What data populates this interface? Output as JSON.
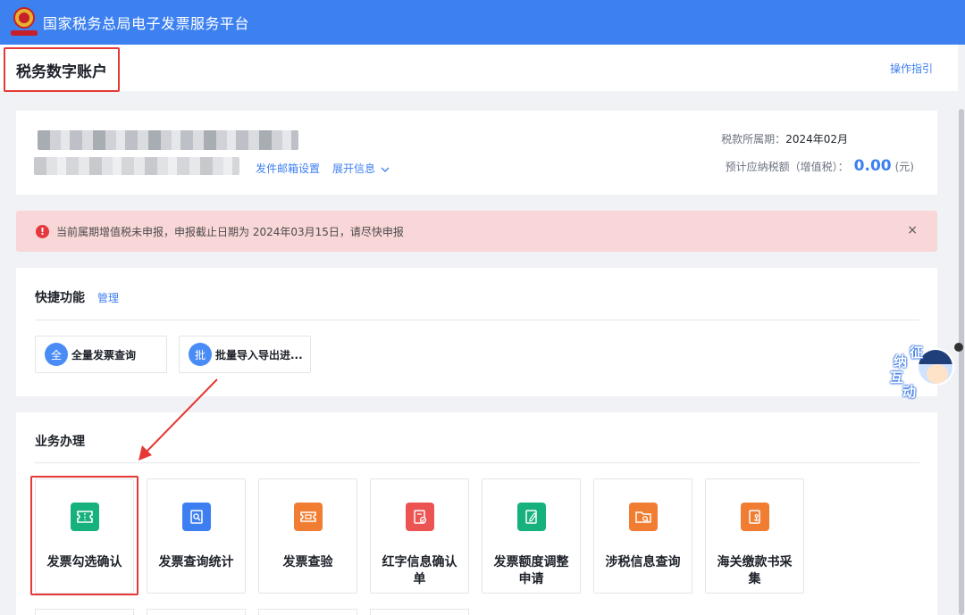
{
  "header": {
    "platform_title": "国家税务总局电子发票服务平台"
  },
  "subheader": {
    "page_title": "税务数字账户",
    "guide_link": "操作指引"
  },
  "account": {
    "mailbox_link": "发件邮箱设置",
    "expand_link": "展开信息",
    "period_label": "税款所属期：",
    "period_value": "2024年02月",
    "tax_label": "预计应纳税额（增值税）：",
    "tax_amount": "0.00",
    "tax_unit": "(元)"
  },
  "alert": {
    "icon": "!",
    "message": "当前属期增值税未申报，申报截止日期为 2024年03月15日，请尽快申报",
    "close": "×"
  },
  "quick": {
    "title": "快捷功能",
    "manage_link": "管理",
    "items": [
      {
        "badge": "全",
        "label": "全量发票查询"
      },
      {
        "badge": "批",
        "label": "批量导入导出进..."
      }
    ]
  },
  "business": {
    "title": "业务办理",
    "tiles": [
      {
        "label": "发票勾选确认",
        "color": "#17b17e",
        "icon": "ticket-icon"
      },
      {
        "label": "发票查询统计",
        "color": "#3d7ff1",
        "icon": "document-search-icon"
      },
      {
        "label": "发票查验",
        "color": "#f07d32",
        "icon": "ticket-check-icon"
      },
      {
        "label": "红字信息确认单",
        "color": "#ec5353",
        "icon": "red-document-icon"
      },
      {
        "label": "发票额度调整申请",
        "color": "#17b17e",
        "icon": "edit-document-icon"
      },
      {
        "label": "涉税信息查询",
        "color": "#f07d32",
        "icon": "folder-search-icon"
      },
      {
        "label": "海关缴款书采集",
        "color": "#f07d32",
        "icon": "anchor-document-icon"
      }
    ]
  },
  "assistant": {
    "chars": [
      "征",
      "纳",
      "互",
      "动"
    ]
  },
  "colors": {
    "primary": "#3d81f1",
    "link": "#3d7ff1",
    "alert_bg": "#f9d6d7",
    "highlight": "#e53935"
  }
}
